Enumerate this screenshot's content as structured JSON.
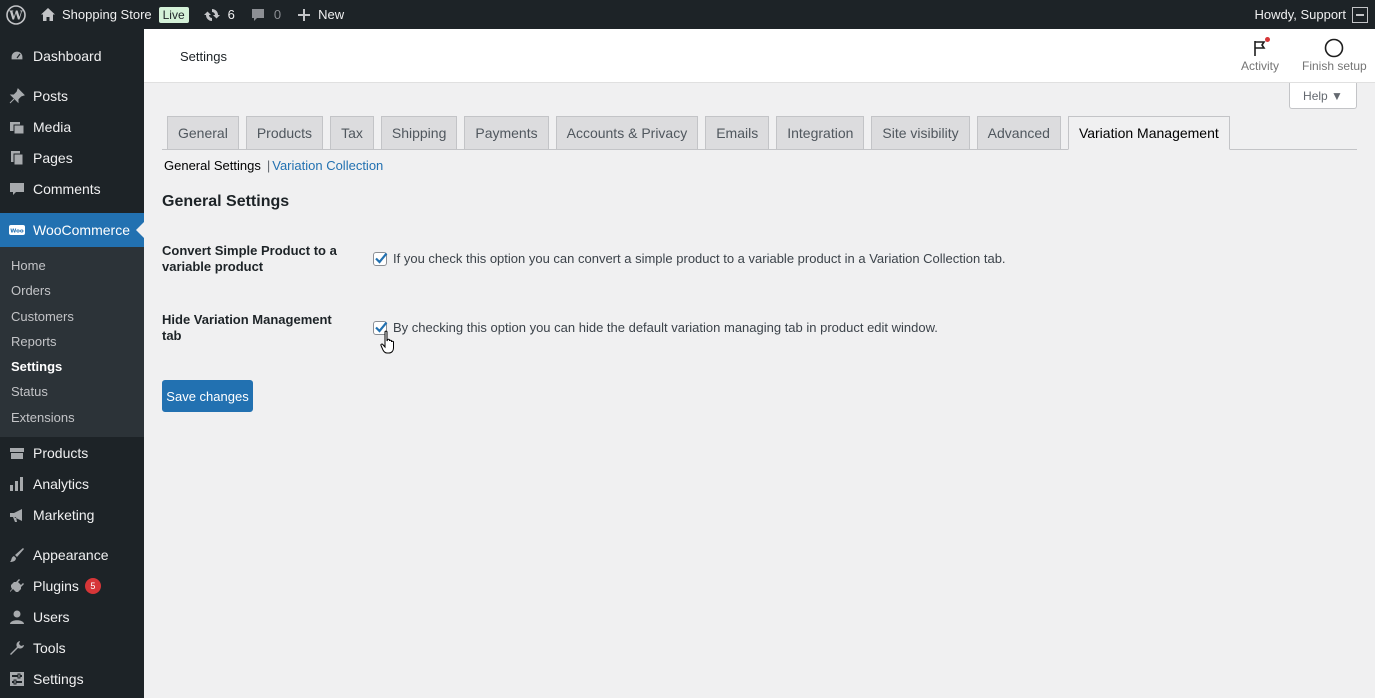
{
  "adminbar": {
    "site_name": "Shopping Store",
    "live_badge": "Live",
    "updates_count": "6",
    "comments_count": "0",
    "new_label": "New",
    "greeting": "Howdy, Support"
  },
  "sidebar": {
    "items_top": [
      {
        "label": "Dashboard",
        "icon": "dashboard-icon"
      },
      {
        "label": "Posts",
        "icon": "pin-icon"
      },
      {
        "label": "Media",
        "icon": "media-icon"
      },
      {
        "label": "Pages",
        "icon": "pages-icon"
      },
      {
        "label": "Comments",
        "icon": "comments-icon"
      }
    ],
    "woocommerce": "WooCommerce",
    "woo_sub": [
      "Home",
      "Orders",
      "Customers",
      "Reports",
      "Settings",
      "Status",
      "Extensions"
    ],
    "items_mid": [
      {
        "label": "Products",
        "icon": "products-icon"
      },
      {
        "label": "Analytics",
        "icon": "analytics-icon"
      },
      {
        "label": "Marketing",
        "icon": "megaphone-icon"
      }
    ],
    "items_bottom": [
      {
        "label": "Appearance",
        "icon": "brush-icon"
      },
      {
        "label": "Plugins",
        "icon": "plugin-icon",
        "badge": "5"
      },
      {
        "label": "Users",
        "icon": "users-icon"
      },
      {
        "label": "Tools",
        "icon": "wrench-icon"
      },
      {
        "label": "Settings",
        "icon": "settings-icon"
      }
    ]
  },
  "header": {
    "title": "Settings",
    "activity": "Activity",
    "finish_setup": "Finish setup"
  },
  "help": "Help ▼",
  "tabs": [
    "General",
    "Products",
    "Tax",
    "Shipping",
    "Payments",
    "Accounts & Privacy",
    "Emails",
    "Integration",
    "Site visibility",
    "Advanced",
    "Variation Management"
  ],
  "active_tab": "Variation Management",
  "subnav": {
    "current": "General Settings",
    "separator": "|",
    "link": "Variation Collection"
  },
  "section_title": "General Settings",
  "fields": [
    {
      "label": "Convert Simple Product to a variable product",
      "description": "If you check this option you can convert a simple product to a variable product in a Variation Collection tab.",
      "checked": true
    },
    {
      "label": "Hide Variation Management tab",
      "description": "By checking this option you can hide the default variation managing tab in product edit window.",
      "checked": true
    }
  ],
  "save_button": "Save changes",
  "colors": {
    "primary": "#2271b1",
    "adminbar": "#1d2327",
    "badge": "#d63638"
  }
}
